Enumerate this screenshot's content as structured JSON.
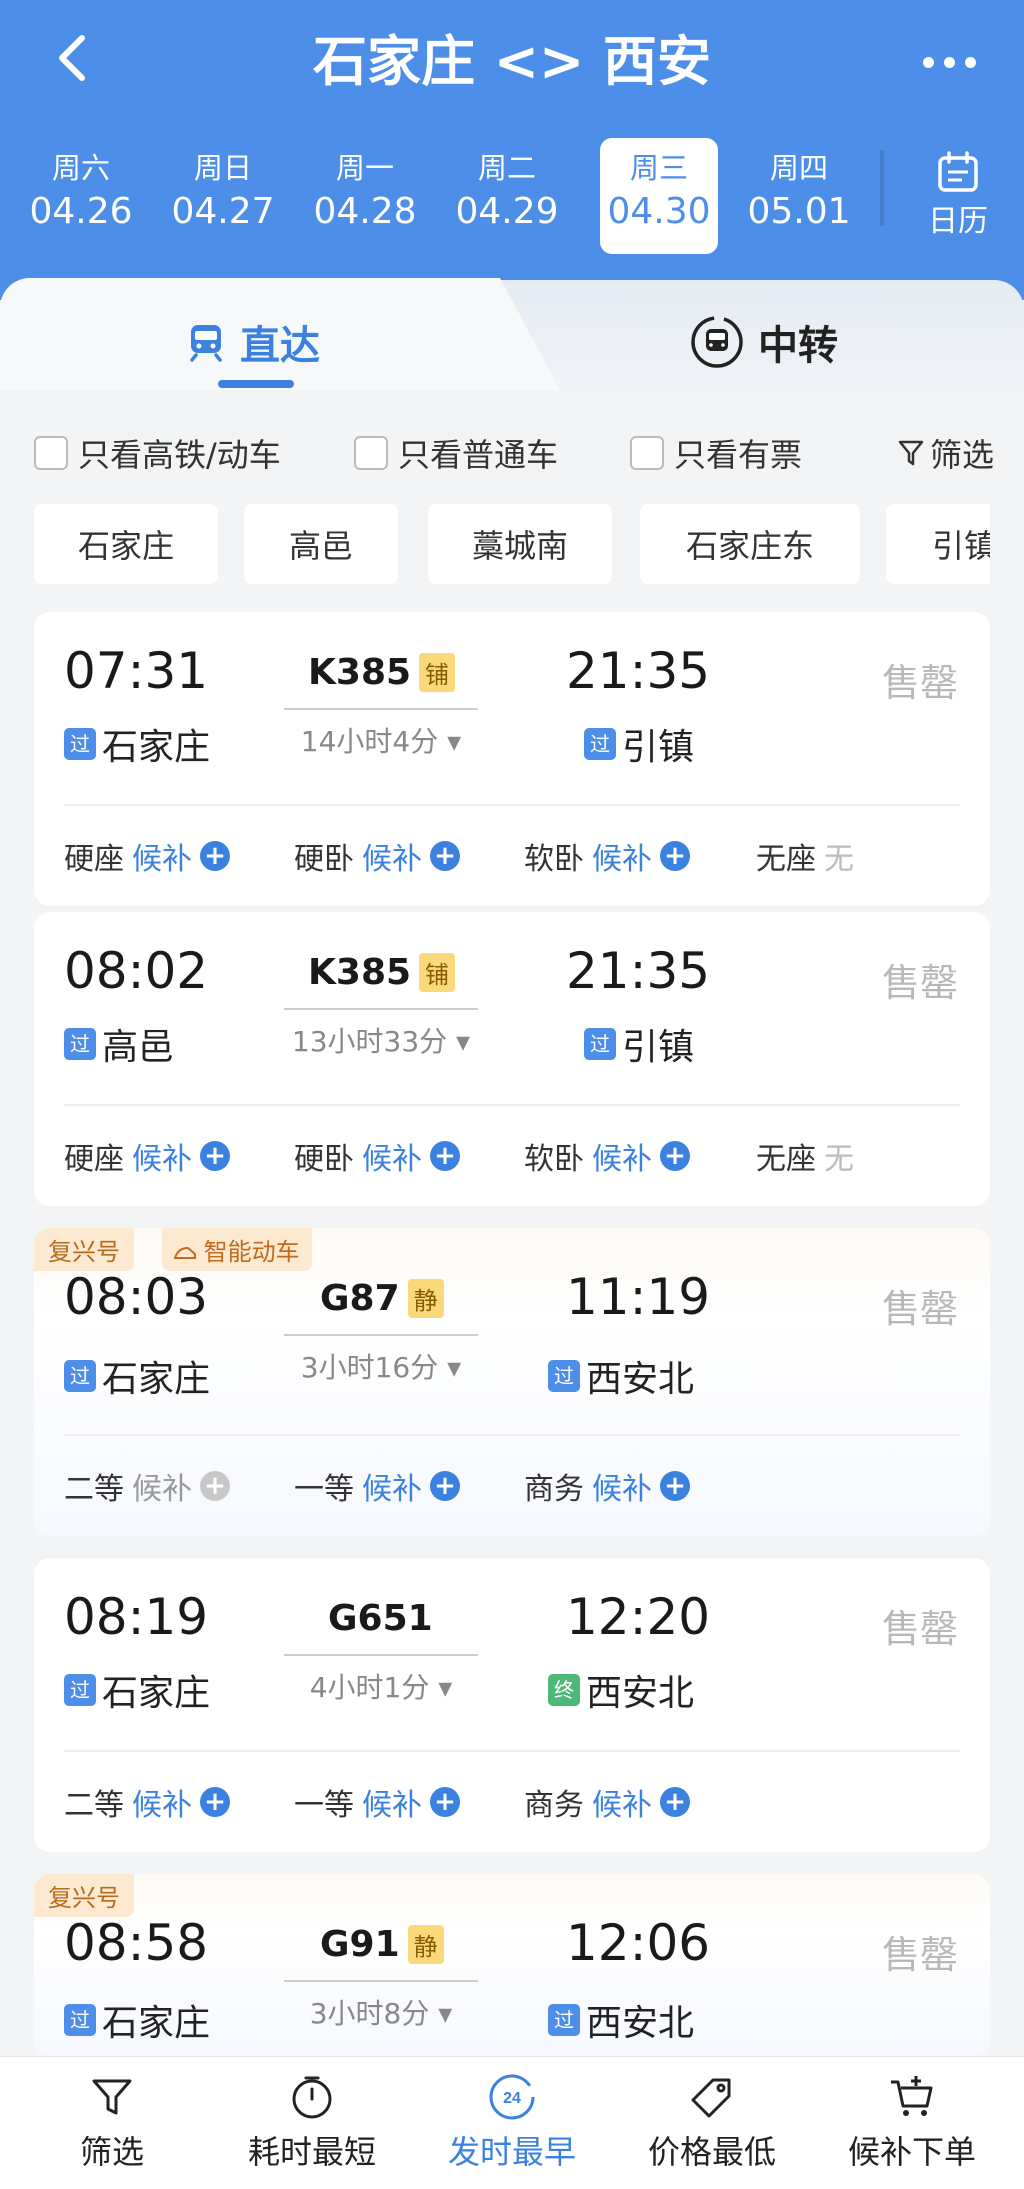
{
  "header": {
    "title": "石家庄 <> 西安"
  },
  "dates": [
    {
      "week": "周六",
      "date": "04.26",
      "active": false
    },
    {
      "week": "周日",
      "date": "04.27",
      "active": false
    },
    {
      "week": "周一",
      "date": "04.28",
      "active": false
    },
    {
      "week": "周二",
      "date": "04.29",
      "active": false
    },
    {
      "week": "周三",
      "date": "04.30",
      "active": true
    },
    {
      "week": "周四",
      "date": "05.01",
      "active": false
    }
  ],
  "calendar_label": "日历",
  "tabs": {
    "direct": "直达",
    "transfer": "中转"
  },
  "filters": {
    "only_hs": "只看高铁/动车",
    "only_normal": "只看普通车",
    "only_avail": "只看有票",
    "filter": "筛选"
  },
  "stations": [
    "石家庄",
    "高邑",
    "藁城南",
    "石家庄东",
    "引镇"
  ],
  "trains": [
    {
      "dep": "07:31",
      "no": "K385",
      "badge": "铺",
      "arr": "21:35",
      "duration": "14小时4分",
      "from_tag": "过",
      "from": "石家庄",
      "to_tag": "过",
      "to": "引镇",
      "status": "售罄",
      "seats": [
        {
          "name": "硬座",
          "val": "候补"
        },
        {
          "name": "硬卧",
          "val": "候补"
        },
        {
          "name": "软卧",
          "val": "候补"
        },
        {
          "name": "无座",
          "val": "无"
        }
      ]
    },
    {
      "dep": "08:02",
      "no": "K385",
      "badge": "铺",
      "arr": "21:35",
      "duration": "13小时33分",
      "from_tag": "过",
      "from": "高邑",
      "to_tag": "过",
      "to": "引镇",
      "status": "售罄",
      "seats": [
        {
          "name": "硬座",
          "val": "候补"
        },
        {
          "name": "硬卧",
          "val": "候补"
        },
        {
          "name": "软卧",
          "val": "候补"
        },
        {
          "name": "无座",
          "val": "无"
        }
      ]
    },
    {
      "tag": "复兴号",
      "smart_tag": "智能动车",
      "dep": "08:03",
      "no": "G87",
      "badge": "静",
      "arr": "11:19",
      "duration": "3小时16分",
      "from_tag": "过",
      "from": "石家庄",
      "to_tag": "过",
      "to": "西安北",
      "status": "售罄",
      "seats": [
        {
          "name": "二等",
          "val": "候补"
        },
        {
          "name": "一等",
          "val": "候补"
        },
        {
          "name": "商务",
          "val": "候补"
        }
      ]
    },
    {
      "dep": "08:19",
      "no": "G651",
      "arr": "12:20",
      "duration": "4小时1分",
      "from_tag": "过",
      "from": "石家庄",
      "to_tag": "终",
      "to": "西安北",
      "status": "售罄",
      "seats": [
        {
          "name": "二等",
          "val": "候补"
        },
        {
          "name": "一等",
          "val": "候补"
        },
        {
          "name": "商务",
          "val": "候补"
        }
      ]
    },
    {
      "tag": "复兴号",
      "dep": "08:58",
      "no": "G91",
      "badge": "静",
      "arr": "12:06",
      "duration": "3小时8分",
      "from_tag": "过",
      "from": "石家庄",
      "to_tag": "过",
      "to": "西安北",
      "status": "售罄"
    }
  ],
  "bottom_nav": [
    "筛选",
    "耗时最短",
    "发时最早",
    "价格最低",
    "候补下单"
  ],
  "bottom_nav_clock_badge": "24",
  "colors": {
    "primary": "#4d8fe8",
    "accent": "#3b82e0",
    "sold": "#b8b8b8"
  }
}
